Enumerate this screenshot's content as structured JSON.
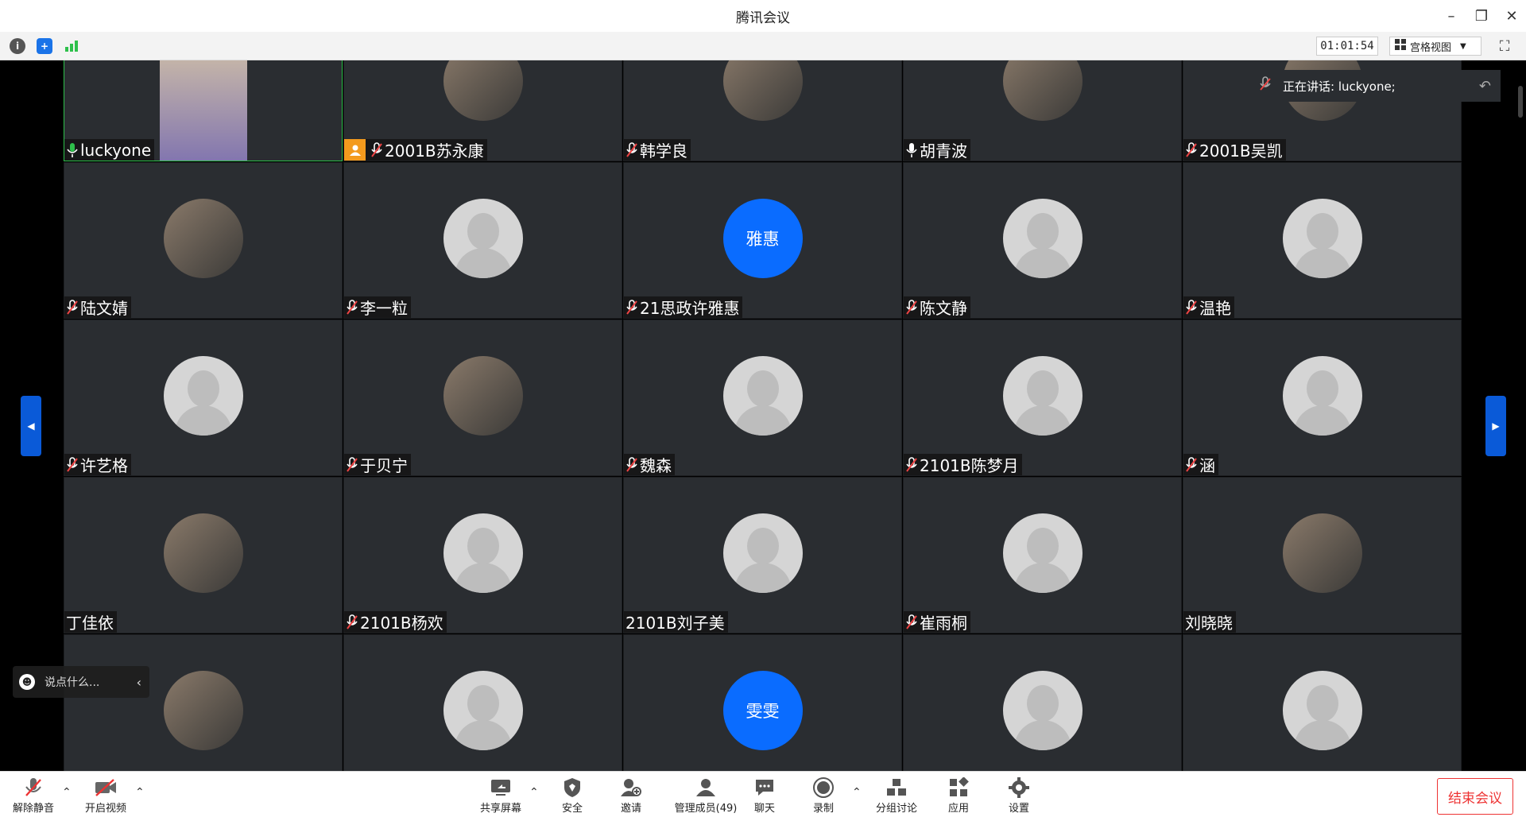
{
  "window": {
    "title": "腾讯会议"
  },
  "toolbar": {
    "timer": "01:01:54",
    "view_label": "宫格视图"
  },
  "speaking": {
    "label": "正在讲话: luckyone;"
  },
  "participants": [
    {
      "name": "luckyone",
      "mic": "on",
      "avatar": "photo",
      "active": true
    },
    {
      "name": "2001B苏永康",
      "mic": "muted",
      "avatar": "photo",
      "host": true
    },
    {
      "name": "韩学良",
      "mic": "muted",
      "avatar": "photo"
    },
    {
      "name": "胡青波",
      "mic": "plain",
      "avatar": "photo"
    },
    {
      "name": "2001B吴凯",
      "mic": "muted",
      "avatar": "photo"
    },
    {
      "name": "陆文婧",
      "mic": "muted",
      "avatar": "photo"
    },
    {
      "name": "李一粒",
      "mic": "muted",
      "avatar": "generic"
    },
    {
      "name": "21思政许雅惠",
      "mic": "muted",
      "avatar": "text",
      "avatar_text": "雅惠"
    },
    {
      "name": "陈文静",
      "mic": "muted",
      "avatar": "generic"
    },
    {
      "name": "温艳",
      "mic": "muted",
      "avatar": "generic"
    },
    {
      "name": "许艺格",
      "mic": "muted",
      "avatar": "generic"
    },
    {
      "name": "于贝宁",
      "mic": "muted",
      "avatar": "photo"
    },
    {
      "name": "魏森",
      "mic": "muted",
      "avatar": "generic"
    },
    {
      "name": "2101B陈梦月",
      "mic": "muted",
      "avatar": "generic"
    },
    {
      "name": "涵",
      "mic": "muted",
      "avatar": "generic"
    },
    {
      "name": "丁佳依",
      "mic": "none",
      "avatar": "photo"
    },
    {
      "name": "2101B杨欢",
      "mic": "muted",
      "avatar": "generic"
    },
    {
      "name": "2101B刘子美",
      "mic": "none",
      "avatar": "generic"
    },
    {
      "name": "崔雨桐",
      "mic": "muted",
      "avatar": "generic"
    },
    {
      "name": "刘晓晓",
      "mic": "none",
      "avatar": "photo"
    },
    {
      "name": "",
      "mic": "none",
      "avatar": "photo"
    },
    {
      "name": "",
      "mic": "none",
      "avatar": "generic"
    },
    {
      "name": "",
      "mic": "none",
      "avatar": "text",
      "avatar_text": "雯雯"
    },
    {
      "name": "",
      "mic": "none",
      "avatar": "generic"
    },
    {
      "name": "",
      "mic": "none",
      "avatar": "generic"
    }
  ],
  "chat": {
    "placeholder": "说点什么..."
  },
  "bottom": {
    "unmute": "解除静音",
    "video": "开启视频",
    "share": "共享屏幕",
    "security": "安全",
    "invite": "邀请",
    "members": "管理成员(49)",
    "chat": "聊天",
    "record": "录制",
    "breakout": "分组讨论",
    "apps": "应用",
    "settings": "设置",
    "end": "结束会议"
  },
  "colors": {
    "accent": "#0a6cff",
    "end": "#e33333",
    "active_border": "#2ec04b",
    "tile_bg": "#2a2d31"
  }
}
